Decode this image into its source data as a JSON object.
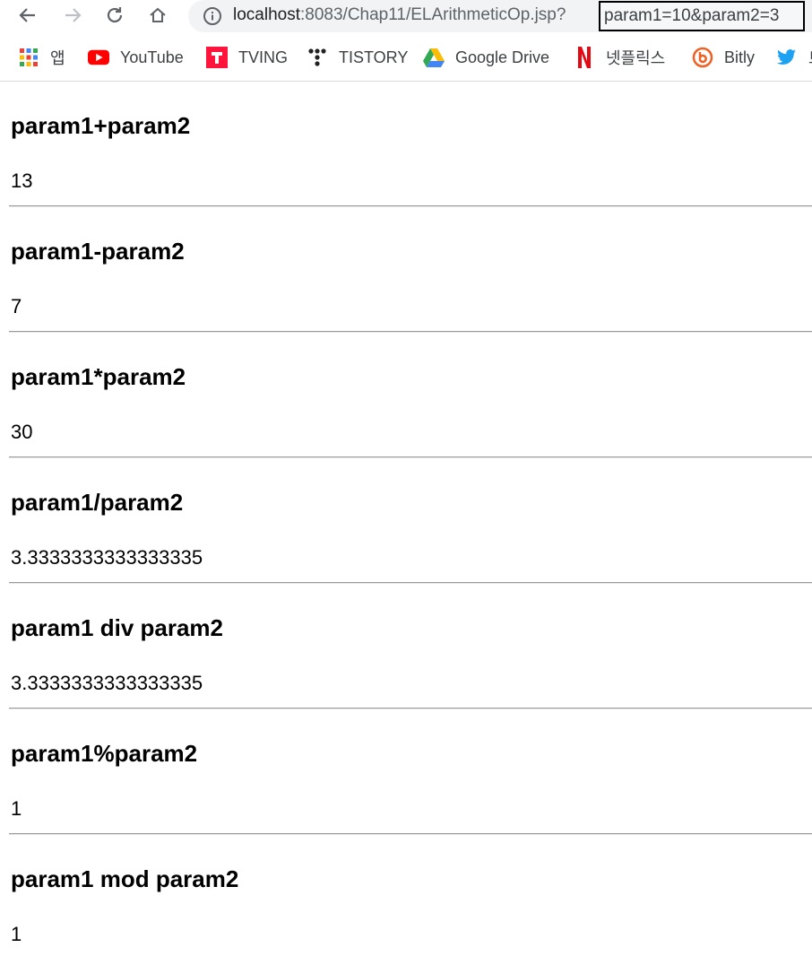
{
  "browser": {
    "url_host": "localhost",
    "url_rest": ":8083/Chap11/ELArithmeticOp.jsp?",
    "url_query": "param1=10&param2=3",
    "bookmarks": [
      {
        "label": "앱",
        "icon": "apps-grid-icon"
      },
      {
        "label": "YouTube",
        "icon": "youtube-icon"
      },
      {
        "label": "TVING",
        "icon": "tving-icon"
      },
      {
        "label": "TISTORY",
        "icon": "tistory-icon"
      },
      {
        "label": "Google Drive",
        "icon": "google-drive-icon"
      },
      {
        "label": "넷플릭스",
        "icon": "netflix-icon"
      },
      {
        "label": "Bitly",
        "icon": "bitly-icon"
      },
      {
        "label": "트",
        "icon": "twitter-icon"
      }
    ]
  },
  "results": [
    {
      "expr": "param1+param2",
      "value": "13"
    },
    {
      "expr": "param1-param2",
      "value": "7"
    },
    {
      "expr": "param1*param2",
      "value": "30"
    },
    {
      "expr": "param1/param2",
      "value": "3.3333333333333335"
    },
    {
      "expr": "param1 div param2",
      "value": "3.3333333333333335"
    },
    {
      "expr": "param1%param2",
      "value": "1"
    },
    {
      "expr": "param1 mod param2",
      "value": "1"
    }
  ]
}
